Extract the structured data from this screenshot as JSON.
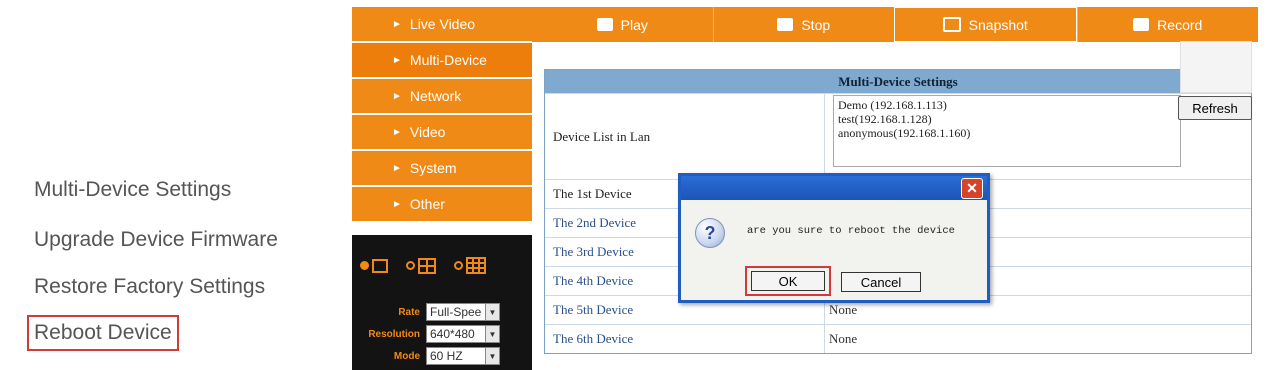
{
  "outer_menu": {
    "items": [
      {
        "label": "Multi-Device Settings"
      },
      {
        "label": "Upgrade Device Firmware"
      },
      {
        "label": "Restore Factory Settings"
      },
      {
        "label": "Reboot Device"
      }
    ]
  },
  "toolbar": {
    "play": "Play",
    "stop": "Stop",
    "snapshot": "Snapshot",
    "record": "Record"
  },
  "nav": {
    "items": [
      {
        "label": "Live Video"
      },
      {
        "label": "Multi-Device"
      },
      {
        "label": "Network"
      },
      {
        "label": "Video"
      },
      {
        "label": "System"
      },
      {
        "label": "Other"
      }
    ],
    "selected": "Multi-Device"
  },
  "controls": {
    "rate_label": "Rate",
    "rate_value": "Full-Spee",
    "resolution_label": "Resolution",
    "resolution_value": "640*480",
    "mode_label": "Mode",
    "mode_value": "60 HZ"
  },
  "panel": {
    "title": "Multi-Device Settings",
    "device_list_label": "Device List in Lan",
    "device_list": [
      "Demo (192.168.1.113)",
      "test(192.168.1.128)",
      "anonymous(192.168.1.160)"
    ],
    "refresh_label": "Refresh",
    "rows": [
      {
        "label": "The 1st Device",
        "value": ""
      },
      {
        "label": "The 2nd Device",
        "value": ""
      },
      {
        "label": "The 3rd Device",
        "value": ""
      },
      {
        "label": "The 4th Device",
        "value": ""
      },
      {
        "label": "The 5th Device",
        "value": "None"
      },
      {
        "label": "The 6th Device",
        "value": "None"
      }
    ]
  },
  "dialog": {
    "message": "are you sure to reboot the device",
    "ok_label": "OK",
    "cancel_label": "Cancel"
  },
  "colors": {
    "accent": "#f08a16",
    "highlight": "#d03a3a",
    "table_header": "#7fa9cf"
  }
}
